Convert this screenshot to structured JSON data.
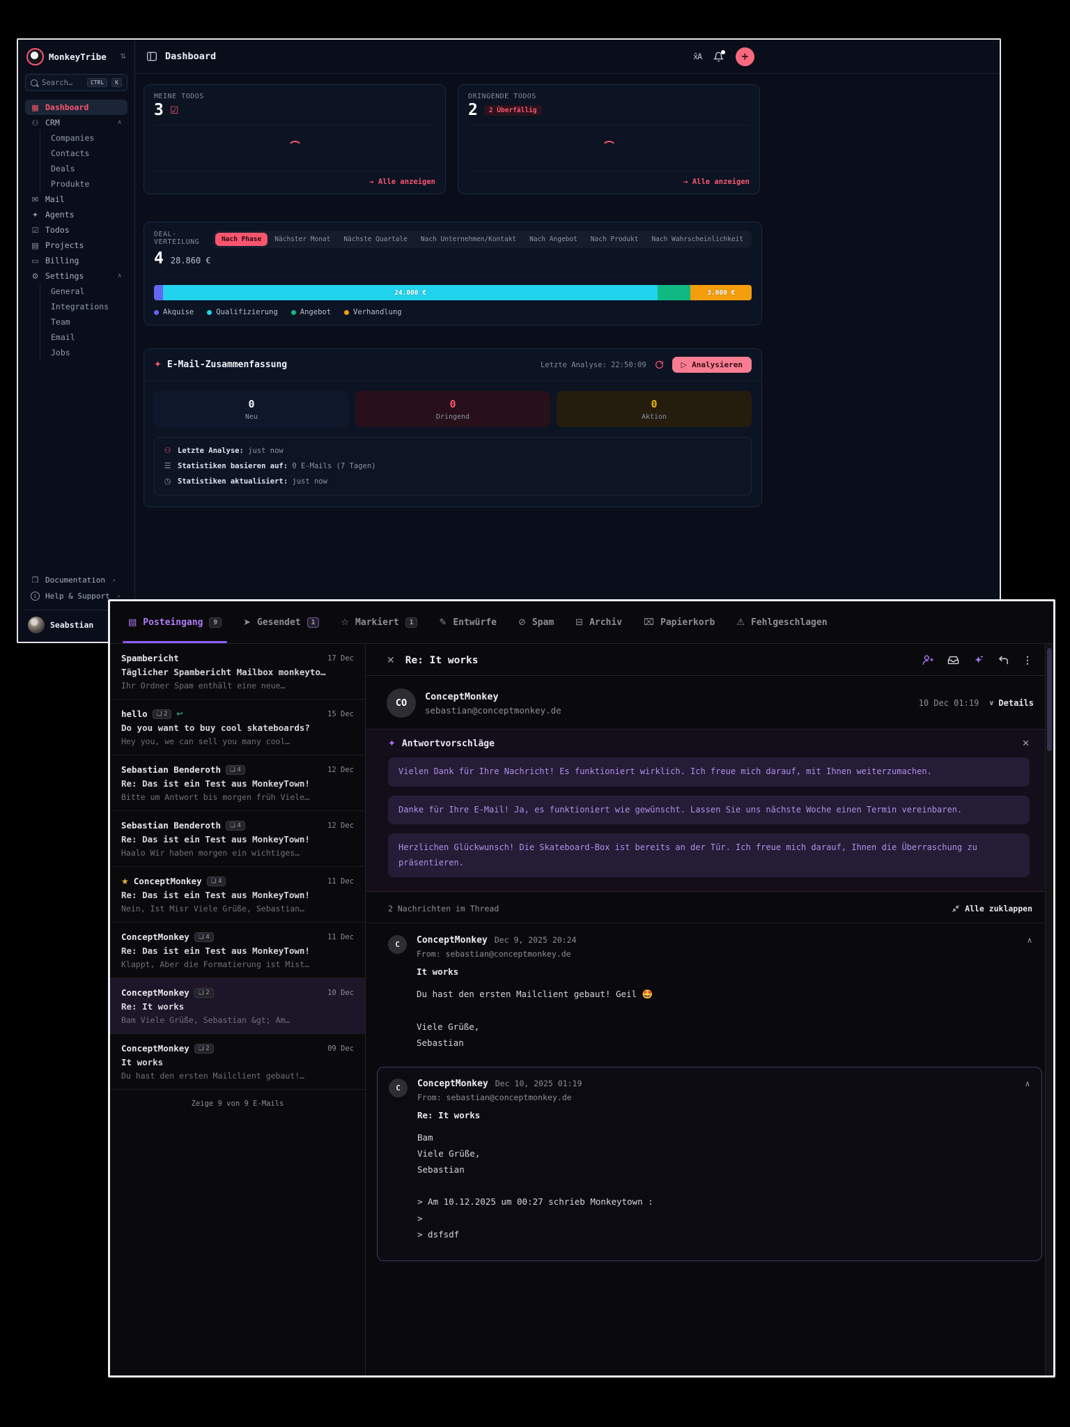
{
  "colors": {
    "accent_red": "#f8566e",
    "accent_purple": "#8b5cf6",
    "cyan": "#22d3ee",
    "green": "#10b981",
    "orange": "#f59e0b",
    "indigo": "#6366f1",
    "yellow": "#eab308"
  },
  "app": {
    "name": "MonkeyTribe",
    "user": "Seabstian"
  },
  "sidebar": {
    "search": {
      "placeholder": "Search…",
      "kbd1": "CTRL",
      "kbd2": "K"
    },
    "items": [
      {
        "icon": "▦",
        "label": "Dashboard",
        "cls": "active",
        "chevron": ""
      },
      {
        "icon": "⚇",
        "label": "CRM",
        "chevron": "∧"
      },
      {
        "icon": "",
        "label": "Companies",
        "cls": "child"
      },
      {
        "icon": "",
        "label": "Contacts",
        "cls": "child"
      },
      {
        "icon": "",
        "label": "Deals",
        "cls": "child"
      },
      {
        "icon": "",
        "label": "Produkte",
        "cls": "child"
      },
      {
        "icon": "✉",
        "label": "Mail"
      },
      {
        "icon": "✦",
        "label": "Agents"
      },
      {
        "icon": "☑",
        "label": "Todos"
      },
      {
        "icon": "▤",
        "label": "Projects"
      },
      {
        "icon": "▭",
        "label": "Billing"
      },
      {
        "icon": "⚙",
        "label": "Settings",
        "chevron": "∧"
      },
      {
        "icon": "",
        "label": "General",
        "cls": "child"
      },
      {
        "icon": "",
        "label": "Integrations",
        "cls": "child"
      },
      {
        "icon": "",
        "label": "Team",
        "cls": "child"
      },
      {
        "icon": "",
        "label": "Email",
        "cls": "child"
      },
      {
        "icon": "",
        "label": "Jobs",
        "cls": "child"
      }
    ],
    "docs_label": "Documentation",
    "help_label": "Help & Support"
  },
  "header": {
    "title": "Dashboard",
    "translate_icon": "x̄A"
  },
  "todo_cards": [
    {
      "label": "MEINE TODOS",
      "count": "3",
      "check": "☑",
      "badge": "",
      "link": "→ Alle anzeigen"
    },
    {
      "label": "DRINGENDE TODOS",
      "count": "2",
      "check": "",
      "badge": "2 Überfällig",
      "link": "→ Alle anzeigen"
    }
  ],
  "deals": {
    "label": "DEAL-VERTEILUNG",
    "count": "4",
    "total": "28.860 €",
    "tabs": [
      {
        "label": "Nach Phase",
        "cls": "active"
      },
      {
        "label": "Nächster Monat"
      },
      {
        "label": "Nächste Quartale"
      },
      {
        "label": "Nach Unternehmen/Kontakt"
      },
      {
        "label": "Nach Angebot"
      },
      {
        "label": "Nach Produkt"
      },
      {
        "label": "Nach Wahrscheinlichkeit"
      }
    ],
    "chart_data": {
      "type": "bar",
      "title": "DEAL-VERTEILUNG",
      "segments": [
        {
          "name": "Akquise",
          "value_label": "",
          "pct": 1.5,
          "color": "#6366f1",
          "style": "width:1.5%;background:#6366f1"
        },
        {
          "name": "Qualifizierung",
          "value_label": "24.000 €",
          "pct": 82.8,
          "color": "#22d3ee",
          "style": "width:82.8%;background:#22d3ee"
        },
        {
          "name": "Angebot",
          "value_label": "",
          "pct": 5.5,
          "color": "#10b981",
          "style": "width:5.5%;background:#10b981"
        },
        {
          "name": "Verhandlung",
          "value_label": "3.000 €",
          "pct": 10.2,
          "color": "#f59e0b",
          "style": "width:10.2%;background:#f59e0b"
        }
      ]
    },
    "legend": [
      {
        "label": "Akquise",
        "style": "background:#6366f1"
      },
      {
        "label": "Qualifizierung",
        "style": "background:#22d3ee"
      },
      {
        "label": "Angebot",
        "style": "background:#10b981"
      },
      {
        "label": "Verhandlung",
        "style": "background:#f59e0b"
      }
    ]
  },
  "email_summary": {
    "title": "E-Mail-Zusammenfassung",
    "last_analysis": "Letzte Analyse: 22:50:09",
    "analyze_play": "▷",
    "analyze_label": "Analysieren",
    "stats": [
      {
        "value": "0",
        "label": "Neu",
        "cls": "neu"
      },
      {
        "value": "0",
        "label": "Dringend",
        "cls": "dringend"
      },
      {
        "value": "0",
        "label": "Aktion",
        "cls": "aktion"
      }
    ],
    "info": [
      {
        "icon": "⚇",
        "icls": "red",
        "label": "Letzte Analyse:",
        "value": "just now"
      },
      {
        "icon": "☰",
        "icls": "",
        "label": "Statistiken basieren auf:",
        "value": "0 E-Mails (7 Tagen)"
      },
      {
        "icon": "◷",
        "icls": "",
        "label": "Statistiken aktualisiert:",
        "value": "just now"
      }
    ]
  },
  "mail": {
    "tabs": [
      {
        "icon": "▤",
        "label": "Posteingang",
        "badge": "9",
        "cls": "active",
        "bcls": ""
      },
      {
        "icon": "➤",
        "label": "Gesendet",
        "badge": "1",
        "bcls": "bp"
      },
      {
        "icon": "☆",
        "label": "Markiert",
        "badge": "1",
        "bcls": ""
      },
      {
        "icon": "✎",
        "label": "Entwürfe",
        "badge": "",
        "bcls": ""
      },
      {
        "icon": "⊘",
        "label": "Spam",
        "badge": "",
        "bcls": ""
      },
      {
        "icon": "⊟",
        "label": "Archiv",
        "badge": "",
        "bcls": ""
      },
      {
        "icon": "⌧",
        "label": "Papierkorb",
        "badge": "",
        "bcls": ""
      },
      {
        "icon": "⚠",
        "label": "Fehlgeschlagen",
        "badge": "",
        "bcls": ""
      }
    ],
    "list": [
      {
        "star": "",
        "sender": "Spambericht",
        "count": "",
        "reply": "",
        "date": "17 Dec",
        "subject": "Täglicher Spambericht Mailbox monkeyto…",
        "preview": "Ihr Ordner Spam enthält eine neue…",
        "cls": ""
      },
      {
        "star": "",
        "sender": "hello",
        "count": "2",
        "reply": "↩",
        "date": "15 Dec",
        "subject": "Do you want to buy cool skateboards?",
        "preview": "Hey you, we can sell you many cool…",
        "cls": ""
      },
      {
        "star": "",
        "sender": "Sebastian Benderoth",
        "count": "4",
        "reply": "",
        "date": "12 Dec",
        "subject": "Re: Das ist ein Test aus MonkeyTown!",
        "preview": "Bitte um Antwort bis morgen früh Viele…",
        "cls": ""
      },
      {
        "star": "",
        "sender": "Sebastian Benderoth",
        "count": "4",
        "reply": "",
        "date": "12 Dec",
        "subject": "Re: Das ist ein Test aus MonkeyTown!",
        "preview": "Haalo Wir haben morgen ein wichtiges…",
        "cls": ""
      },
      {
        "star": "★",
        "sender": "ConceptMonkey",
        "count": "4",
        "reply": "",
        "date": "11 Dec",
        "subject": "Re: Das ist ein Test aus MonkeyTown!",
        "preview": "Nein, Ist Misr Viele Grüße, Sebastian…",
        "cls": ""
      },
      {
        "star": "",
        "sender": "ConceptMonkey",
        "count": "4",
        "reply": "",
        "date": "11 Dec",
        "subject": "Re: Das ist ein Test aus MonkeyTown!",
        "preview": "Klappt, Aber die Formatierung ist Mist…",
        "cls": ""
      },
      {
        "star": "",
        "sender": "ConceptMonkey",
        "count": "2",
        "reply": "",
        "date": "10 Dec",
        "subject": "Re: It works",
        "preview": "Bam Viele Grüße, Sebastian &gt; Am…",
        "cls": "selected"
      },
      {
        "star": "",
        "sender": "ConceptMonkey",
        "count": "2",
        "reply": "",
        "date": "09 Dec",
        "subject": "It works",
        "preview": "Du hast den ersten Mailclient gebaut!…",
        "cls": ""
      }
    ],
    "list_footer": "Zeige 9 von 9 E-Mails",
    "detail": {
      "title": "Re: It works",
      "sender_initials": "CO",
      "sender_name": "ConceptMonkey",
      "sender_email": "sebastian@conceptmonkey.de",
      "date": "10 Dec 01:19",
      "details_label": "Details",
      "suggestions_title": "Antwortvorschläge",
      "suggestions": [
        {
          "text": "Vielen Dank für Ihre Nachricht! Es funktioniert wirklich. Ich freue mich darauf, mit Ihnen weiterzumachen."
        },
        {
          "text": "Danke für Ihre E-Mail! Ja, es funktioniert wie gewünscht. Lassen Sie uns nächste Woche einen Termin vereinbaren."
        },
        {
          "text": "Herzlichen Glückwunsch! Die Skateboard-Box ist bereits an der Tür. Ich freue mich darauf, Ihnen die Überraschung zu präsentieren."
        }
      ],
      "thread_count": "2 Nachrichten im Thread",
      "collapse_label": "Alle zuklappen",
      "messages": [
        {
          "avatar": "C",
          "sender": "ConceptMonkey",
          "date": "Dec 9, 2025 20:24",
          "from": "From: sebastian@conceptmonkey.de",
          "subject": "It works",
          "body": "Du hast den ersten Mailclient gebaut! Geil 🤩\n\nViele Grüße,\nSebastian",
          "cls": "",
          "chevron": "∧"
        },
        {
          "avatar": "C",
          "sender": "ConceptMonkey",
          "date": "Dec 10, 2025 01:19",
          "from": "From: sebastian@conceptmonkey.de",
          "subject": "Re: It works",
          "body": "Bam\nViele Grüße,\nSebastian\n\n> Am 10.12.2025 um 00:27 schrieb Monkeytown :\n>\n> dsfsdf",
          "cls": "bordered",
          "chevron": "∧"
        }
      ]
    }
  }
}
